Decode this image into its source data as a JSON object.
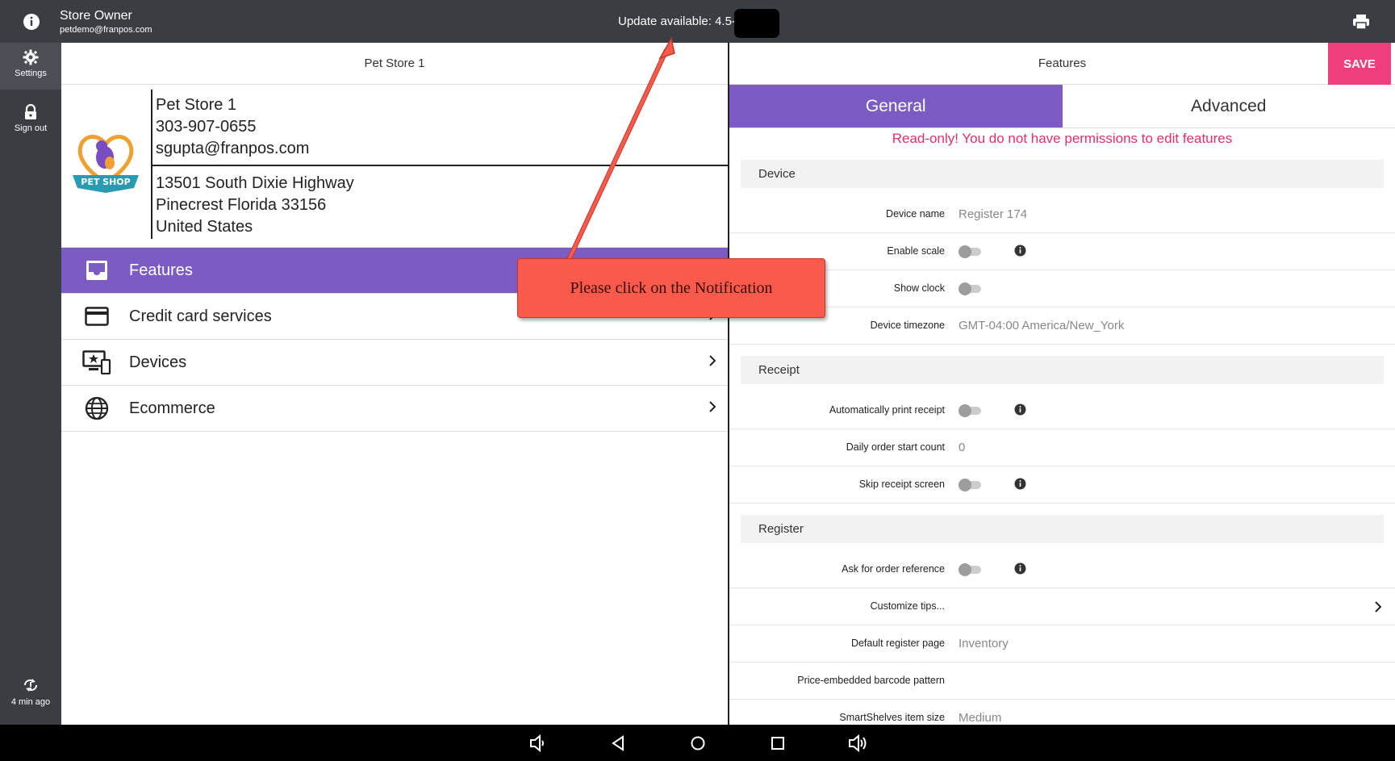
{
  "topbar": {
    "user_name": "Store Owner",
    "user_email": "petdemo@franpos.com",
    "update_text": "Update available: 4.5-"
  },
  "rail": {
    "settings_label": "Settings",
    "signout_label": "Sign out",
    "sync_label": "4 min ago"
  },
  "left": {
    "header": "Pet Store 1",
    "store": {
      "name": "Pet Store 1",
      "phone": "303-907-0655",
      "email": "sgupta@franpos.com",
      "address1": "13501 South Dixie Highway",
      "address2": "Pinecrest Florida 33156",
      "country": "United States",
      "logo_text": "PET SHOP"
    },
    "menu": [
      {
        "label": "Features",
        "icon": "inbox-icon",
        "active": true
      },
      {
        "label": "Credit card services",
        "icon": "credit-card-icon"
      },
      {
        "label": "Devices",
        "icon": "devices-icon"
      },
      {
        "label": "Ecommerce",
        "icon": "globe-icon"
      }
    ]
  },
  "right": {
    "header": "Features",
    "save_label": "SAVE",
    "tabs": [
      "General",
      "Advanced"
    ],
    "readonly_msg": "Read-only! You do not have permissions to edit features",
    "sections": {
      "device": "Device",
      "receipt": "Receipt",
      "register": "Register"
    },
    "device_rows": {
      "device_name_label": "Device name",
      "device_name_value": "Register 174",
      "enable_scale_label": "Enable scale",
      "show_clock_label": "Show clock",
      "timezone_label": "Device timezone",
      "timezone_value": "GMT-04:00 America/New_York"
    },
    "receipt_rows": {
      "auto_print_label": "Automatically print receipt",
      "daily_count_label": "Daily order start count",
      "daily_count_value": "0",
      "skip_receipt_label": "Skip receipt screen"
    },
    "register_rows": {
      "order_ref_label": "Ask for order reference",
      "tips_label": "Customize tips...",
      "default_page_label": "Default register page",
      "default_page_value": "Inventory",
      "barcode_label": "Price-embedded barcode pattern",
      "smartshelves_label": "SmartShelves item size",
      "smartshelves_value": "Medium"
    }
  },
  "annotation": {
    "text": "Please click on the Notification"
  },
  "colors": {
    "accent": "#7c5cc4",
    "save": "#ee3f7c",
    "warning": "#e0306a",
    "callout": "#f95a4b"
  }
}
